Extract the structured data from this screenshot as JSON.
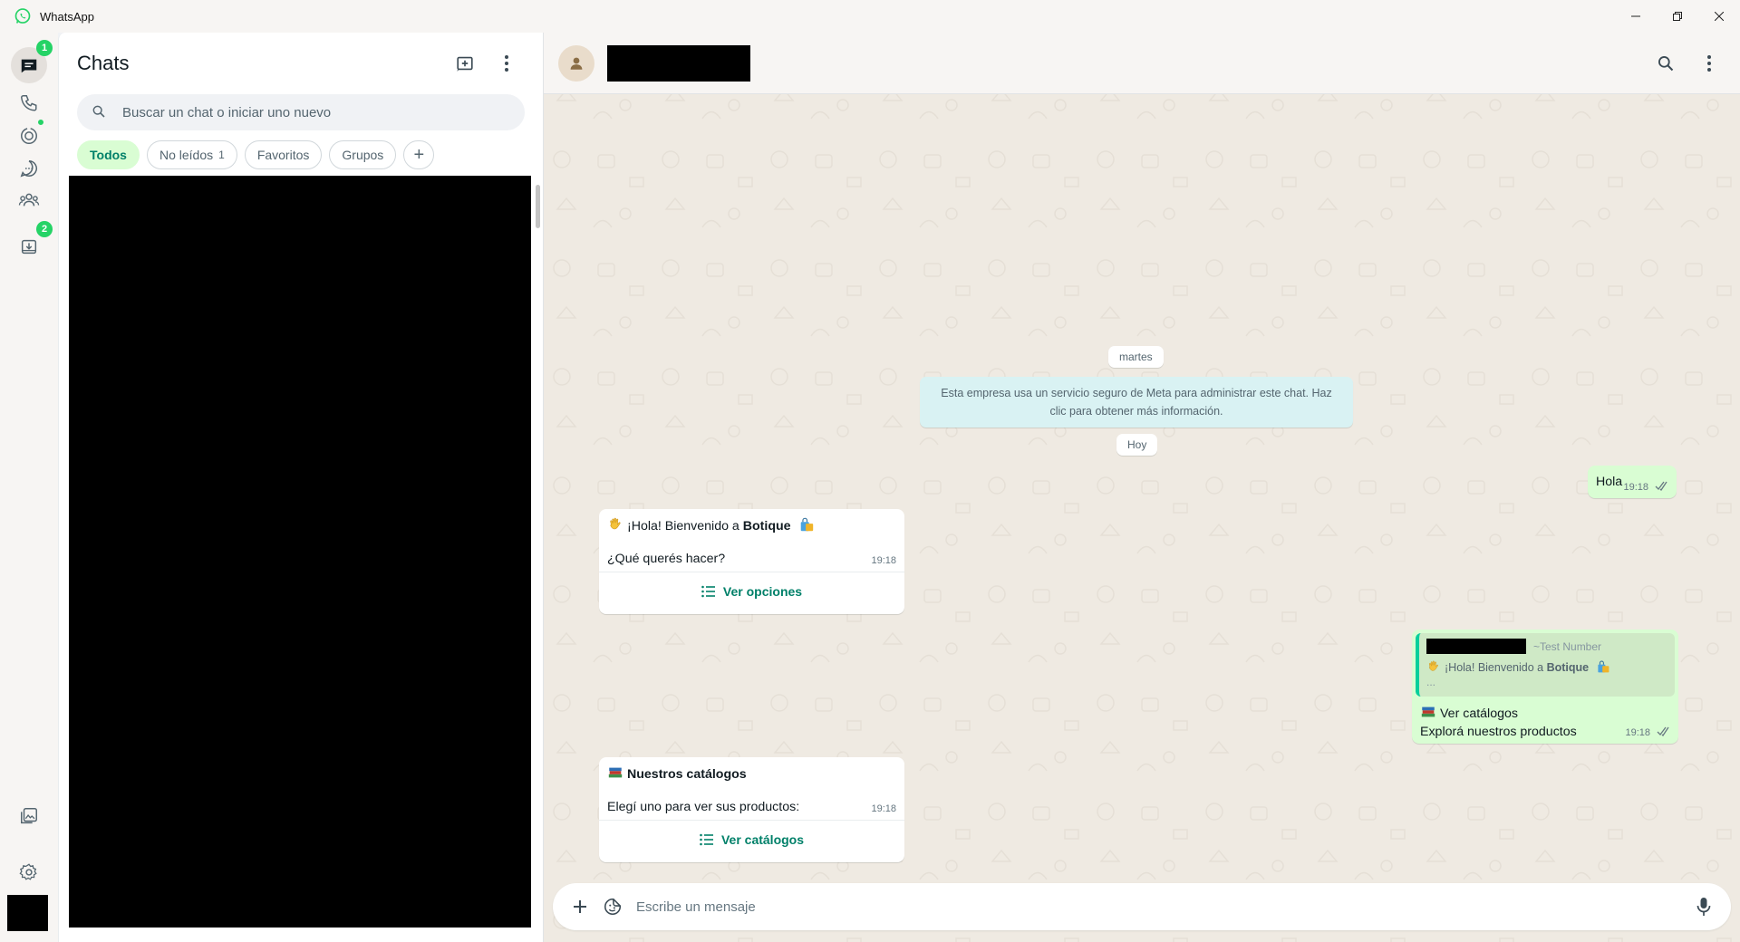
{
  "window": {
    "title": "WhatsApp",
    "controls": [
      "minimize-icon",
      "restore-icon",
      "close-icon"
    ]
  },
  "rail": {
    "items": [
      {
        "name": "chats",
        "icon": "chats-icon",
        "badge": "1",
        "active": true
      },
      {
        "name": "calls",
        "icon": "phone-icon"
      },
      {
        "name": "status",
        "icon": "status-icon",
        "dot": true
      },
      {
        "name": "channels",
        "icon": "channels-icon"
      },
      {
        "name": "communities",
        "icon": "communities-icon"
      },
      {
        "name": "archived",
        "icon": "archive-icon",
        "badge": "2"
      }
    ],
    "bottom": [
      "media-icon",
      "settings-icon"
    ]
  },
  "chat_list": {
    "title": "Chats",
    "search_placeholder": "Buscar un chat o iniciar uno nuevo",
    "filters": [
      {
        "label": "Todos",
        "active": true
      },
      {
        "label": "No leídos",
        "count": "1"
      },
      {
        "label": "Favoritos"
      },
      {
        "label": "Grupos"
      }
    ]
  },
  "conversation": {
    "date_martes": "martes",
    "notice": "Esta empresa usa un servicio seguro de Meta para administrar este chat. Haz clic para obtener más información.",
    "date_hoy": "Hoy",
    "messages": [
      {
        "dir": "out",
        "text": "Hola",
        "time": "19:18",
        "status": "read"
      },
      {
        "dir": "in",
        "line1_prefix": "¡Hola! Bienvenido a ",
        "line1_bold": "Botique",
        "line2": "¿Qué querés hacer?",
        "time": "19:18",
        "action": "Ver opciones"
      },
      {
        "dir": "out",
        "quote_handle": "~Test Number",
        "quote_prefix": "¡Hola! Bienvenido a ",
        "quote_bold": "Botique",
        "quote_more": "...",
        "title": "Ver catálogos",
        "subtitle": "Explorá nuestros productos",
        "time": "19:18",
        "status": "read"
      },
      {
        "dir": "in",
        "title": "Nuestros catálogos",
        "line2": "Elegí uno para ver sus productos:",
        "time": "19:18",
        "action": "Ver catálogos"
      }
    ],
    "composer_placeholder": "Escribe un mensaje"
  },
  "colors": {
    "accent": "#25d366",
    "outgoing_bubble": "#d9fdd3",
    "chat_background": "#efeae2",
    "action_text": "#008069"
  }
}
